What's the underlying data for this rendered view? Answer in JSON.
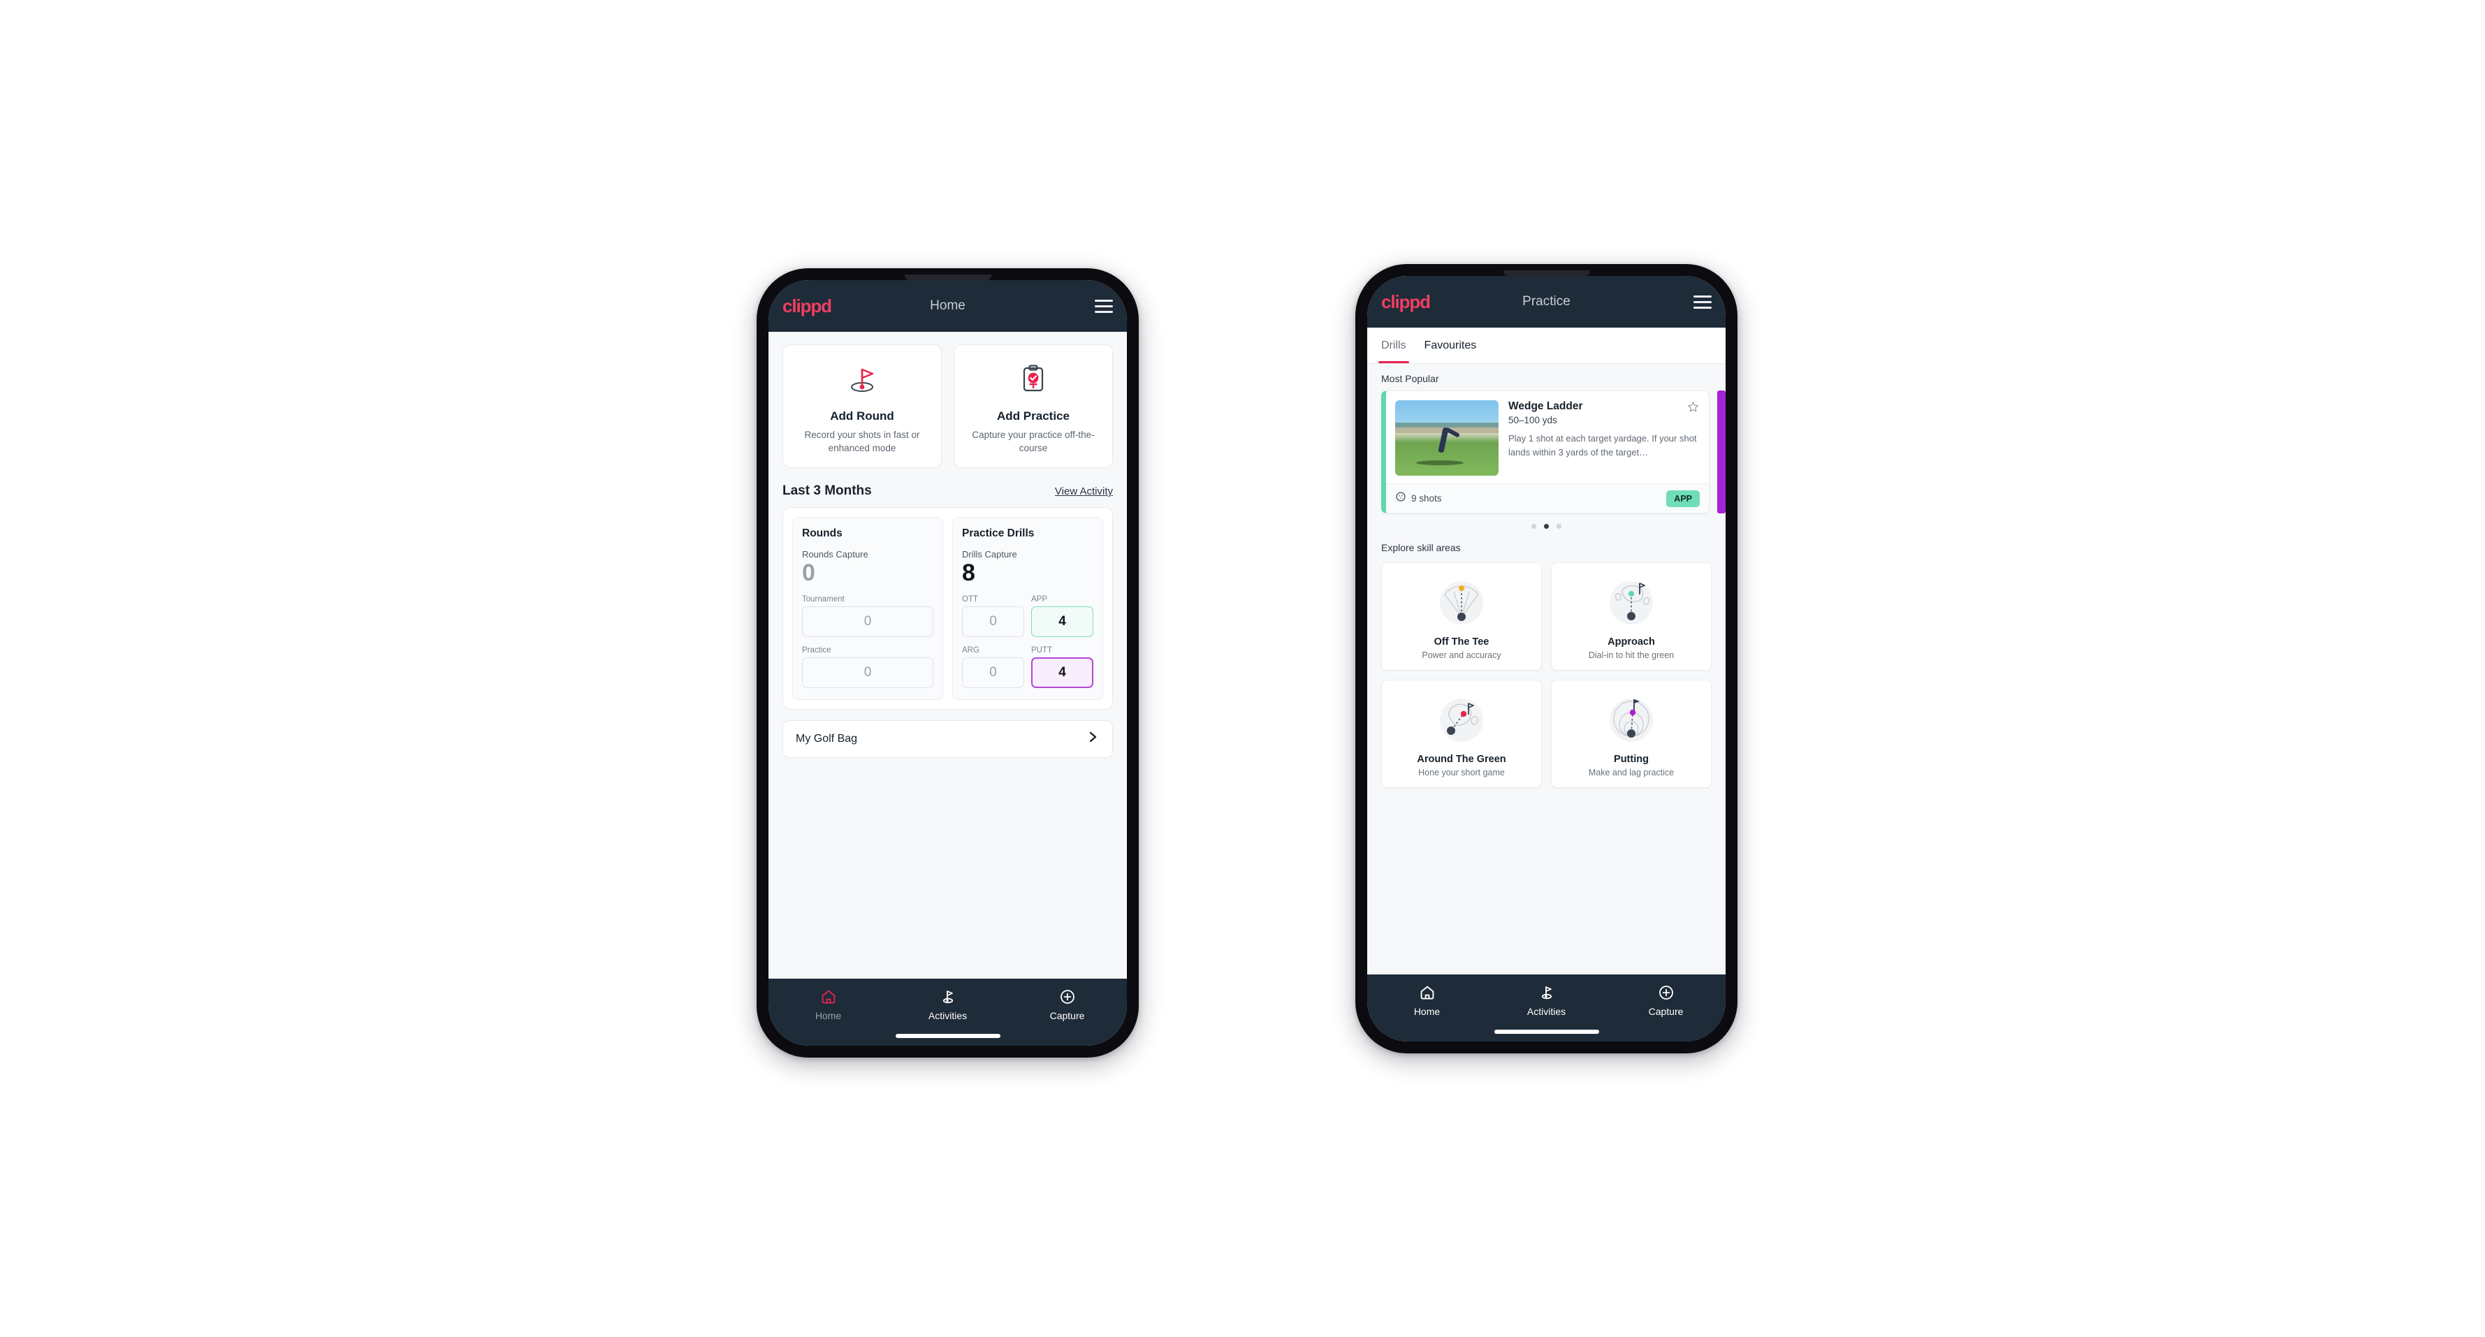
{
  "brand": {
    "logo_text": "clippd",
    "accent": "#ef3e62",
    "dark": "#1e2b38"
  },
  "phone1": {
    "appbar": {
      "title": "Home",
      "menu_icon": "hamburger-menu-icon"
    },
    "actions": [
      {
        "icon": "golf-flag-hole-icon",
        "title": "Add Round",
        "subtitle": "Record your shots in fast or enhanced mode"
      },
      {
        "icon": "clipboard-check-icon",
        "title": "Add Practice",
        "subtitle": "Capture your practice off-the-course"
      }
    ],
    "section": {
      "title": "Last 3 Months",
      "link": "View Activity"
    },
    "rounds": {
      "heading": "Rounds",
      "capture_label": "Rounds Capture",
      "capture_value": "0",
      "fields": [
        {
          "label": "Tournament",
          "value": "0",
          "state": "empty"
        },
        {
          "label": "Practice",
          "value": "0",
          "state": "empty"
        }
      ]
    },
    "drills": {
      "heading": "Practice Drills",
      "capture_label": "Drills Capture",
      "capture_value": "8",
      "fields": [
        {
          "label": "OTT",
          "value": "0",
          "state": "empty"
        },
        {
          "label": "APP",
          "value": "4",
          "state": "app"
        },
        {
          "label": "ARG",
          "value": "0",
          "state": "empty"
        },
        {
          "label": "PUTT",
          "value": "4",
          "state": "putt"
        }
      ]
    },
    "bag": {
      "label": "My Golf Bag",
      "icon": "chevron-right-icon"
    },
    "nav": [
      {
        "icon": "home-icon",
        "label": "Home",
        "active": true
      },
      {
        "icon": "golf-flag-icon",
        "label": "Activities",
        "active": false
      },
      {
        "icon": "plus-circle-icon",
        "label": "Capture",
        "active": false
      }
    ]
  },
  "phone2": {
    "appbar": {
      "title": "Practice",
      "menu_icon": "hamburger-menu-icon"
    },
    "tabs": [
      {
        "label": "Drills",
        "active": true
      },
      {
        "label": "Favourites",
        "active": false
      }
    ],
    "most_popular_label": "Most Popular",
    "drill": {
      "title": "Wedge Ladder",
      "range": "50–100 yds",
      "description": "Play 1 shot at each target yardage. If your shot lands within 3 yards of the target…",
      "shots": "9 shots",
      "shots_icon": "target-ball-icon",
      "badge": "APP",
      "badge_color": "#6fddb6",
      "accent_color": "#62d6ae",
      "next_accent_color": "#a622d8",
      "favourite_icon": "star-outline-icon"
    },
    "carousel_dots": {
      "count": 3,
      "active_index": 1
    },
    "skills_label": "Explore skill areas",
    "skills": [
      {
        "icon": "tee-shot-fan-icon",
        "name": "Off The Tee",
        "sub": "Power and accuracy",
        "dot": "#f0ad2a"
      },
      {
        "icon": "approach-green-icon",
        "name": "Approach",
        "sub": "Dial-in to hit the green",
        "dot": "#5fd6b0"
      },
      {
        "icon": "chip-green-icon",
        "name": "Around The Green",
        "sub": "Hone your short game",
        "dot": "#e6244f"
      },
      {
        "icon": "putting-rings-icon",
        "name": "Putting",
        "sub": "Make and lag practice",
        "dot": "#a622d8"
      }
    ],
    "nav": [
      {
        "icon": "home-icon",
        "label": "Home",
        "active": false
      },
      {
        "icon": "golf-flag-icon",
        "label": "Activities",
        "active": false
      },
      {
        "icon": "plus-circle-icon",
        "label": "Capture",
        "active": false
      }
    ]
  }
}
